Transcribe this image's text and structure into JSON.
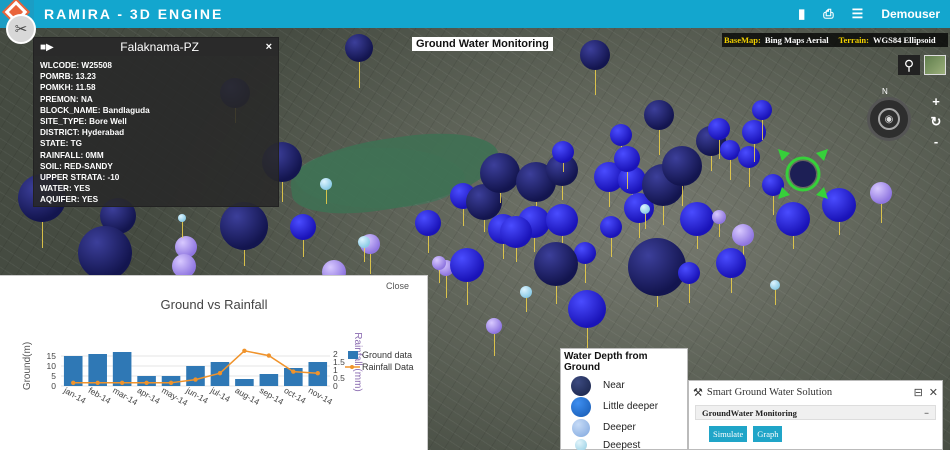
{
  "app": {
    "title": "RAMIRA - 3D ENGINE",
    "user": "Demouser"
  },
  "toolbar": {
    "icons": [
      "bookmark-icon",
      "print-icon",
      "layers-icon"
    ]
  },
  "map": {
    "title": "Ground Water Monitoring",
    "basemap_label": "BaseMap:",
    "basemap_value": "Bing Maps Aerial",
    "terrain_label": "Terrain:",
    "terrain_value": "WGS84 Ellipsoid",
    "compass_letter": "N",
    "zoom_in": "+",
    "zoom_reset": "↻",
    "zoom_out": "-"
  },
  "info_panel": {
    "title": "Falaknama-PZ",
    "close": "×",
    "lines": [
      "WLCODE: W25508",
      "POMRB: 13.23",
      "POMKH: 11.58",
      "PREMON: NA",
      "BLOCK_NAME: Bandlaguda",
      "SITE_TYPE: Bore Well",
      "DISTRICT: Hyderabad",
      "STATE: TG",
      "RAINFALL: 0MM",
      "SOIL: RED-SANDY",
      "UPPER STRATA: -10",
      "WATER: YES",
      "AQUIFER: YES"
    ]
  },
  "chart_panel": {
    "close_label": "Close"
  },
  "chart_data": {
    "type": "bar",
    "title": "Ground vs Rainfall",
    "categories": [
      "Jan-14",
      "Feb-14",
      "Mar-14",
      "Apr-14",
      "May-14",
      "Jun-14",
      "Jul-14",
      "Aug-14",
      "Sep-14",
      "Oct-14",
      "Nov-14"
    ],
    "ylabel": "Ground(m)",
    "y2label": "Rainfall (mm)",
    "ylim": [
      0,
      20
    ],
    "y2lim": [
      0,
      2.5
    ],
    "yticks": [
      0,
      5,
      10,
      15
    ],
    "y2ticks": [
      0,
      0.5,
      1,
      1.5,
      2
    ],
    "series": [
      {
        "name": "Ground data",
        "type": "bar",
        "axis": "left",
        "color": "#2f78b5",
        "values": [
          15,
          16,
          17,
          5,
          5,
          10,
          12,
          3.5,
          6,
          9,
          12
        ]
      },
      {
        "name": "Rainfall Data",
        "type": "line",
        "axis": "right",
        "color": "#f0932b",
        "values": [
          0.2,
          0.2,
          0.2,
          0.2,
          0.2,
          0.4,
          0.8,
          2.2,
          1.9,
          0.9,
          0.8
        ]
      }
    ],
    "legend": "right"
  },
  "legend": {
    "title": "Water Depth from Ground",
    "items": [
      {
        "label": "Near",
        "color": "#1e2b5a"
      },
      {
        "label": "Little deeper",
        "color": "#1a68c6"
      },
      {
        "label": "Deeper",
        "color": "#8fb3e6"
      },
      {
        "label": "Deepest",
        "color": "#a9d8ea"
      }
    ]
  },
  "smart_panel": {
    "title": "Smart Ground Water Solution",
    "section": "GroundWater Monitoring",
    "collapse": "−",
    "buttons": [
      "Simulate",
      "Graph"
    ]
  }
}
